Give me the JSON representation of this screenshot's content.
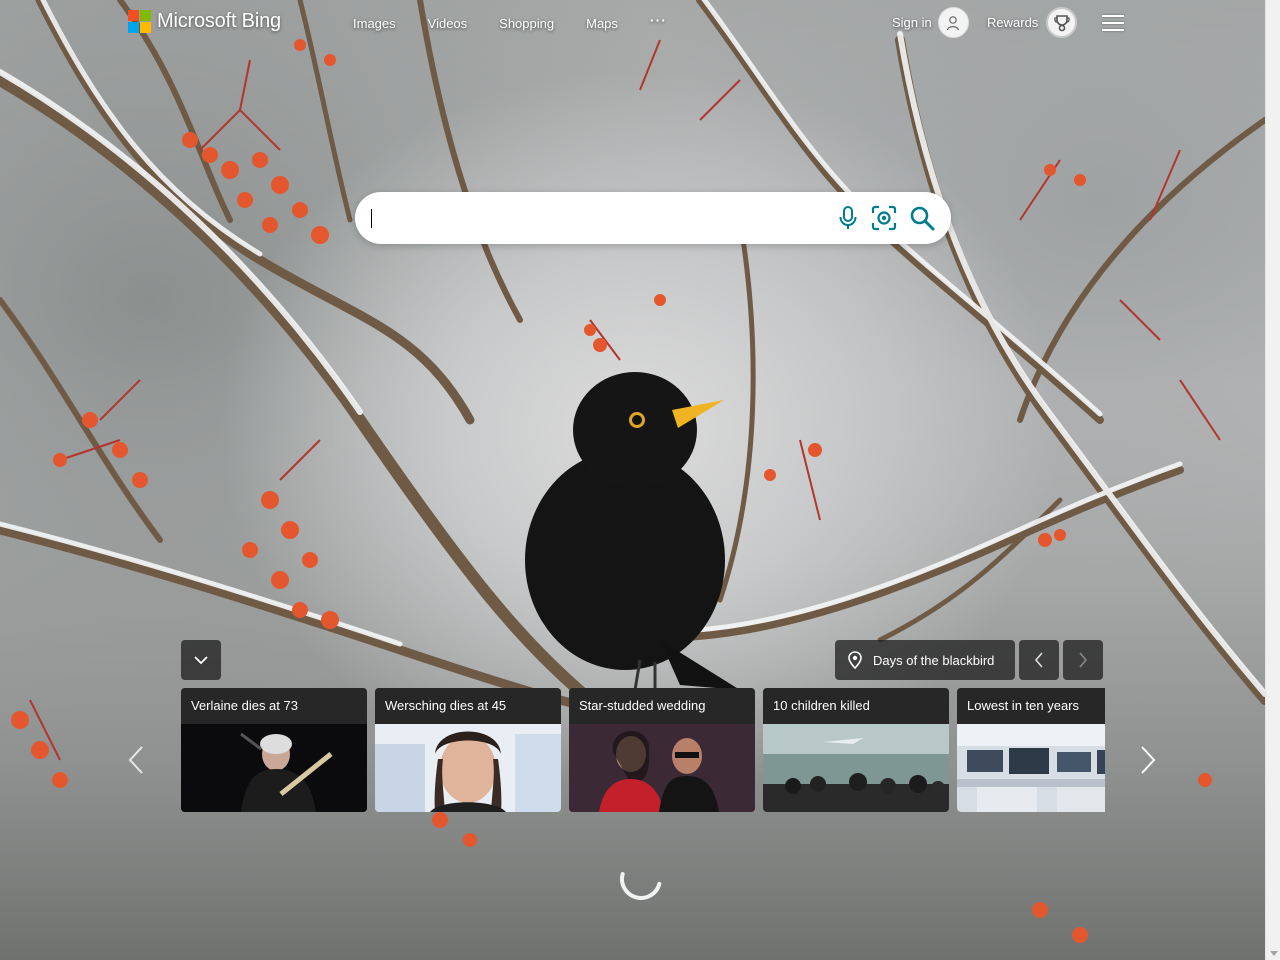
{
  "brand": {
    "name": "Microsoft Bing"
  },
  "nav": {
    "items": [
      "Images",
      "Videos",
      "Shopping",
      "Maps"
    ],
    "more_label": "···"
  },
  "account": {
    "signin_label": "Sign in",
    "rewards_label": "Rewards"
  },
  "search": {
    "placeholder": "",
    "value": ""
  },
  "image_of_day": {
    "title": "Days of the blackbird"
  },
  "news": [
    {
      "headline": "Verlaine dies at 73"
    },
    {
      "headline": "Wersching dies at 45"
    },
    {
      "headline": "Star-studded wedding"
    },
    {
      "headline": "10 children killed"
    },
    {
      "headline": "Lowest in ten years"
    }
  ],
  "icons": {
    "microphone": "microphone-icon",
    "visual_search": "visual-search-icon",
    "search": "search-icon",
    "location": "location-pin-icon",
    "rewards": "rewards-trophy-icon"
  },
  "colors": {
    "search_icon_accent": "#007c8f"
  }
}
